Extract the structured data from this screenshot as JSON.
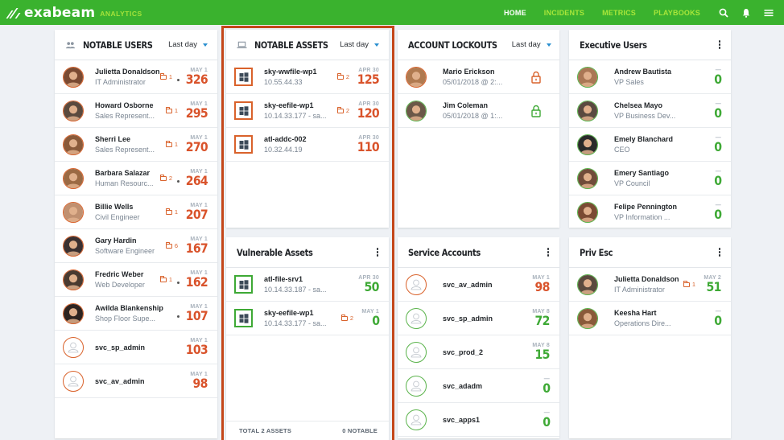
{
  "topbar": {
    "logo_text": "exabeam",
    "logo_sub": "ANALYTICS",
    "nav": [
      {
        "label": "HOME",
        "active": true
      },
      {
        "label": "INCIDENTS",
        "active": false
      },
      {
        "label": "METRICS",
        "active": false
      },
      {
        "label": "PLAYBOOKS",
        "active": false
      }
    ],
    "icons": [
      "search-icon",
      "bell-icon",
      "menu-icon"
    ]
  },
  "colors": {
    "brand_green": "#3ab22e",
    "nav_inactive": "#a8e63a",
    "risk_orange": "#d9532b",
    "safe_green": "#3ea935",
    "highlight": "#c4471a",
    "caret_blue": "#2a8fd0"
  },
  "notable_users": {
    "title": "NOTABLE USERS",
    "range": "Last day",
    "rows": [
      {
        "name": "Julietta Donaldson",
        "title": "IT Administrator",
        "count": "1",
        "dot": true,
        "date": "MAY 1",
        "score": "326"
      },
      {
        "name": "Howard Osborne",
        "title": "Sales Represent...",
        "count": "1",
        "dot": false,
        "date": "MAY 1",
        "score": "295"
      },
      {
        "name": "Sherri Lee",
        "title": "Sales Represent...",
        "count": "1",
        "dot": false,
        "date": "MAY 1",
        "score": "270"
      },
      {
        "name": "Barbara Salazar",
        "title": "Human Resourc...",
        "count": "2",
        "dot": true,
        "date": "MAY 1",
        "score": "264"
      },
      {
        "name": "Billie Wells",
        "title": "Civil Engineer",
        "count": "1",
        "dot": false,
        "date": "MAY 1",
        "score": "207"
      },
      {
        "name": "Gary Hardin",
        "title": "Software Engineer",
        "count": "6",
        "dot": false,
        "date": "MAY 1",
        "score": "167"
      },
      {
        "name": "Fredric Weber",
        "title": "Web Developer",
        "count": "1",
        "dot": true,
        "date": "MAY 1",
        "score": "162"
      },
      {
        "name": "Awilda Blankenship",
        "title": "Shop Floor Supe...",
        "count": "",
        "dot": true,
        "date": "MAY 1",
        "score": "107"
      },
      {
        "name": "svc_sp_admin",
        "title": "",
        "count": "",
        "dot": false,
        "date": "MAY 1",
        "score": "103"
      },
      {
        "name": "svc_av_admin",
        "title": "",
        "count": "",
        "dot": false,
        "date": "MAY 1",
        "score": "98"
      }
    ]
  },
  "notable_assets": {
    "title": "NOTABLE ASSETS",
    "range": "Last day",
    "rows": [
      {
        "name": "sky-wwfile-wp1",
        "ip": "10.55.44.33",
        "count": "2",
        "date": "APR 30",
        "score": "125"
      },
      {
        "name": "sky-eefile-wp1",
        "ip": "10.14.33.177 - sa...",
        "count": "2",
        "date": "APR 30",
        "score": "120"
      },
      {
        "name": "atl-addc-002",
        "ip": "10.32.44.19",
        "count": "",
        "date": "APR 30",
        "score": "110"
      }
    ]
  },
  "vulnerable_assets": {
    "title": "Vulnerable Assets",
    "rows": [
      {
        "name": "atl-file-srv1",
        "ip": "10.14.33.187 - sa...",
        "count": "",
        "date": "APR 30",
        "score": "50"
      },
      {
        "name": "sky-eefile-wp1",
        "ip": "10.14.33.177 - sa...",
        "count": "2",
        "date": "MAY 1",
        "score": "0"
      }
    ],
    "footer_total": "TOTAL 2 ASSETS",
    "footer_notable": "0 NOTABLE"
  },
  "account_lockouts": {
    "title": "ACCOUNT LOCKOUTS",
    "range": "Last day",
    "rows": [
      {
        "name": "Mario Erickson",
        "time": "05/01/2018 @ 2:...",
        "status": "locked"
      },
      {
        "name": "Jim Coleman",
        "time": "05/01/2018 @ 1:...",
        "status": "unlocked"
      }
    ]
  },
  "service_accounts": {
    "title": "Service Accounts",
    "rows": [
      {
        "name": "svc_av_admin",
        "date": "MAY 1",
        "score": "98",
        "risk": "high"
      },
      {
        "name": "svc_sp_admin",
        "date": "MAY 8",
        "score": "72",
        "risk": "low"
      },
      {
        "name": "svc_prod_2",
        "date": "MAY 8",
        "score": "15",
        "risk": "low"
      },
      {
        "name": "svc_adadm",
        "date": "—",
        "score": "0",
        "risk": "low"
      },
      {
        "name": "svc_apps1",
        "date": "—",
        "score": "0",
        "risk": "low"
      }
    ]
  },
  "executive_users": {
    "title": "Executive Users",
    "rows": [
      {
        "name": "Andrew Bautista",
        "title": "VP Sales",
        "date": "—",
        "score": "0"
      },
      {
        "name": "Chelsea Mayo",
        "title": "VP Business Dev...",
        "date": "—",
        "score": "0"
      },
      {
        "name": "Emely Blanchard",
        "title": "CEO",
        "date": "—",
        "score": "0"
      },
      {
        "name": "Emery Santiago",
        "title": "VP Council",
        "date": "—",
        "score": "0"
      },
      {
        "name": "Felipe Pennington",
        "title": "VP Information ...",
        "date": "—",
        "score": "0"
      }
    ]
  },
  "priv_esc": {
    "title": "Priv Esc",
    "rows": [
      {
        "name": "Julietta Donaldson",
        "title": "IT Administrator",
        "count": "1",
        "date": "MAY 2",
        "score": "51"
      },
      {
        "name": "Keesha Hart",
        "title": "Operations Dire...",
        "count": "",
        "date": "—",
        "score": "0"
      }
    ]
  }
}
